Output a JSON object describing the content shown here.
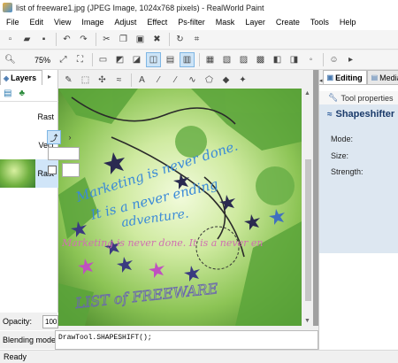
{
  "window": {
    "title": "list of freeware1.jpg (JPEG Image, 1024x768 pixels) - RealWorld Paint"
  },
  "menu": [
    "File",
    "Edit",
    "View",
    "Image",
    "Adjust",
    "Effect",
    "Ps-filter",
    "Mask",
    "Layer",
    "Create",
    "Tools",
    "Help"
  ],
  "toolbar": {
    "zoom": "75%"
  },
  "layers_panel": {
    "tab_label": "Layers",
    "layers": [
      {
        "label": "Rast"
      },
      {
        "label": "Vect"
      },
      {
        "label": "Rast"
      }
    ],
    "opacity_label": "Opacity:",
    "opacity_value": "100",
    "blending_label": "Blending mode:"
  },
  "canvas": {
    "texts": [
      {
        "text": "Marketing is never done.",
        "color": "#3a8ad8"
      },
      {
        "text": "It is a never ending",
        "color": "#3a8ad8"
      },
      {
        "text": "adventure.",
        "color": "#3a8ad8"
      },
      {
        "text": "Marketing is never done. It is a never en",
        "color": "#d070b0"
      },
      {
        "text": "LIST of FREEWARE",
        "color": "#6a66b0"
      }
    ]
  },
  "console": {
    "text": "DrawTool.SHAPESHIFT();"
  },
  "right_panel": {
    "tabs": [
      {
        "label": "Editing",
        "active": true
      },
      {
        "label": "Media",
        "active": false
      }
    ],
    "section_title": "Tool properties",
    "tool_name": "Shapeshifter",
    "mode_label": "Mode:",
    "size_label": "Size:",
    "strength_label": "Strength:"
  },
  "status": {
    "text": "Ready"
  }
}
